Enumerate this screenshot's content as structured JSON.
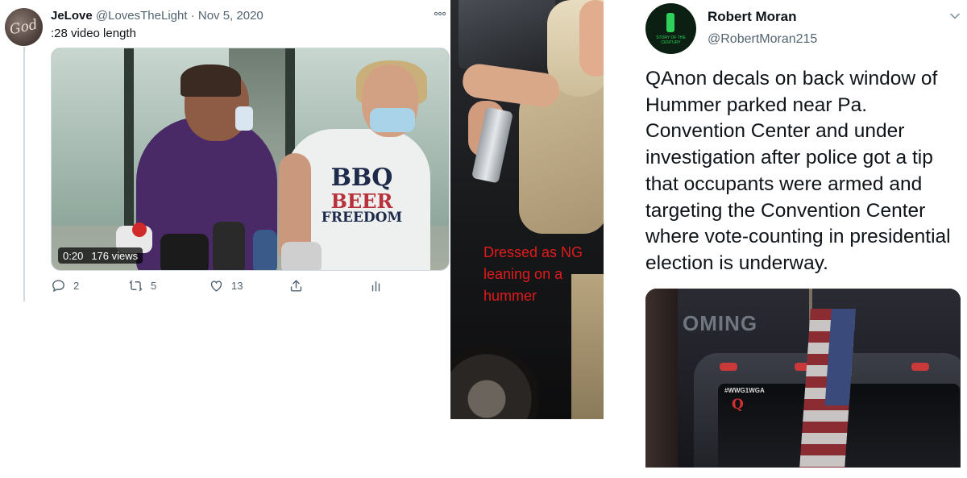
{
  "left_tweet": {
    "name": "JeLove",
    "handle": "@LovesTheLight",
    "separator": "·",
    "date": "Nov 5, 2020",
    "more_icon": "more-horizontal-icon",
    "text": ":28 video length",
    "avatar_text": "God",
    "video": {
      "timestamp": "0:20",
      "views": "176 views",
      "shirt_lines": [
        "BBQ",
        "BEER",
        "FREEDOM"
      ]
    },
    "actions": {
      "reply_count": "2",
      "retweet_count": "5",
      "like_count": "13",
      "reply_icon": "reply-icon",
      "retweet_icon": "retweet-icon",
      "like_icon": "heart-icon",
      "share_icon": "share-icon",
      "analytics_icon": "analytics-icon"
    },
    "colors": {
      "secondary_text": "#536471",
      "thread_line": "#cfd9de"
    }
  },
  "middle_photo": {
    "caption": "Dressed as NG leaning on a hummer",
    "caption_color": "#e11b1b"
  },
  "right_tweet": {
    "name": "Robert Moran",
    "handle": "@RobertMoran215",
    "chevron_icon": "chevron-down-icon",
    "text": "QAnon decals on back window of Hummer parked near Pa. Convention Center and under investigation after police got a tip that occupants were armed and targeting the Convention Center where vote-counting in presidential election is underway.",
    "avatar_caption": "STORY OF THE CENTURY",
    "media": {
      "sign_text": "OMING",
      "decal_text": "#WWG1WGA",
      "decal_q": "Q"
    }
  }
}
